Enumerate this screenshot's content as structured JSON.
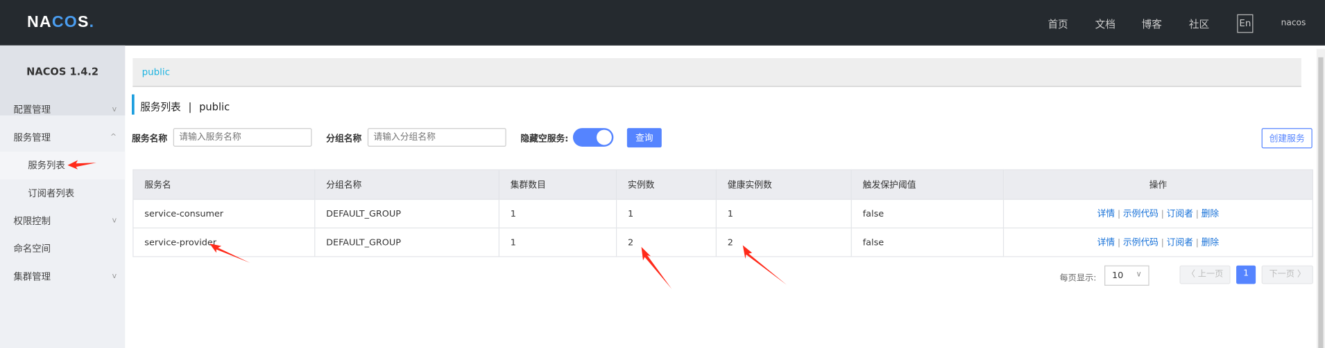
{
  "header": {
    "logo": "NACOS.",
    "nav": [
      "首页",
      "文档",
      "博客",
      "社区"
    ],
    "lang": "En",
    "user": "nacos"
  },
  "sidebar": {
    "version": "NACOS 1.4.2",
    "items": [
      {
        "label": "配置管理",
        "chevron": "v"
      },
      {
        "label": "服务管理",
        "chevron": "^"
      },
      {
        "label": "服务列表"
      },
      {
        "label": "订阅者列表"
      },
      {
        "label": "权限控制",
        "chevron": "v"
      },
      {
        "label": "命名空间"
      },
      {
        "label": "集群管理",
        "chevron": "v"
      }
    ]
  },
  "breadcrumb": "public",
  "page": {
    "title": "服务列表",
    "sep": "|",
    "namespace": "public"
  },
  "filters": {
    "service_label": "服务名称",
    "service_placeholder": "请输入服务名称",
    "group_label": "分组名称",
    "group_placeholder": "请输入分组名称",
    "hide_empty_label": "隐藏空服务:",
    "hide_empty": true,
    "query": "查询",
    "create": "创建服务"
  },
  "table": {
    "headers": [
      "服务名",
      "分组名称",
      "集群数目",
      "实例数",
      "健康实例数",
      "触发保护阈值",
      "操作"
    ],
    "rows": [
      {
        "name": "service-consumer",
        "group": "DEFAULT_GROUP",
        "clusters": "1",
        "instances": "1",
        "healthy": "1",
        "threshold": "false"
      },
      {
        "name": "service-provider",
        "group": "DEFAULT_GROUP",
        "clusters": "1",
        "instances": "2",
        "healthy": "2",
        "threshold": "false"
      }
    ],
    "actions": [
      "详情",
      "示例代码",
      "订阅者",
      "删除"
    ]
  },
  "pagination": {
    "page_size_label": "每页显示:",
    "page_size": "10",
    "prev": "〈 上一页",
    "current": "1",
    "next": "下一页 〉"
  },
  "colors": {
    "header": "#252a2f",
    "primary": "#5584ff",
    "link": "#1771d8",
    "crumb": "#1cb3e0",
    "annotation": "#ff2a1a"
  }
}
